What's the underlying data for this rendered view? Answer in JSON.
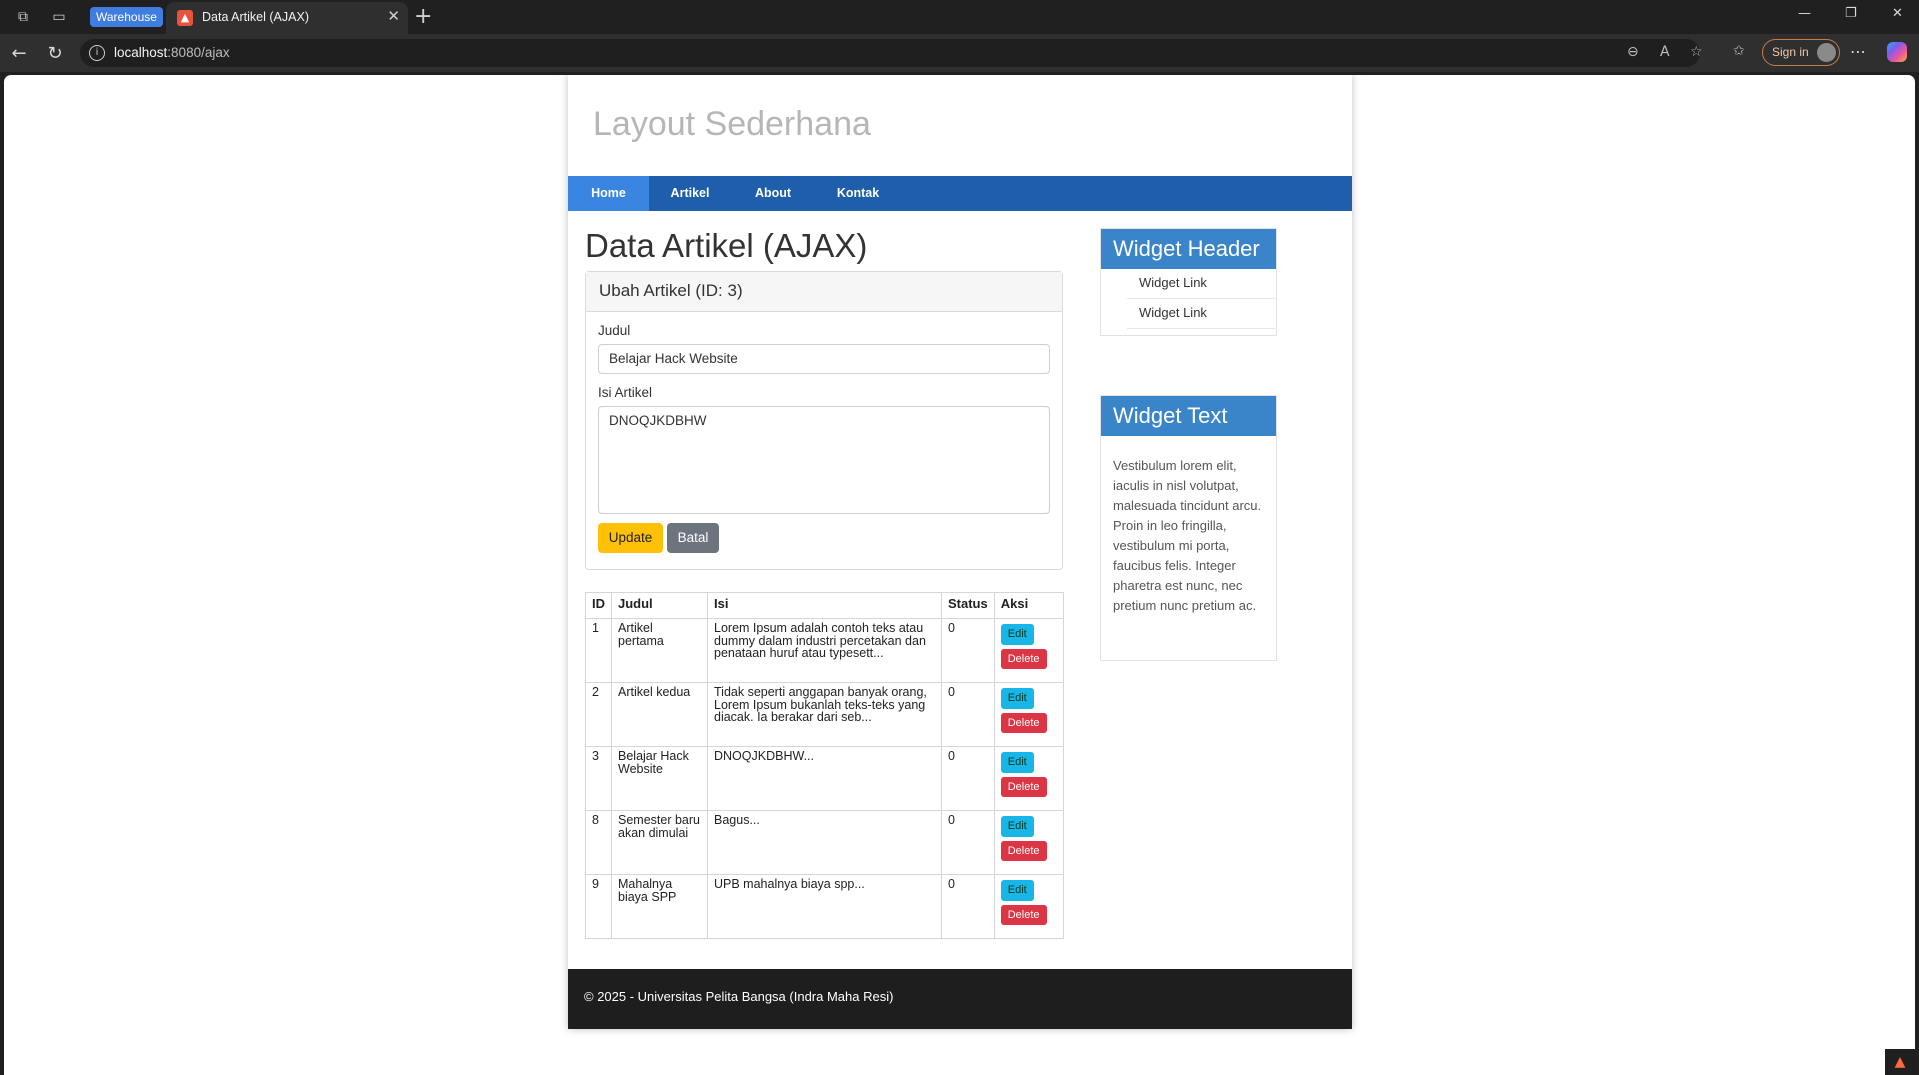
{
  "browser": {
    "workspace_label": "Warehouse",
    "tab_title": "Data Artikel (AJAX)",
    "url_host": "localhost",
    "url_rest": ":8080/ajax",
    "signin_label": "Sign in"
  },
  "site": {
    "title": "Layout Sederhana",
    "nav": [
      {
        "label": "Home",
        "active": true
      },
      {
        "label": "Artikel",
        "active": false
      },
      {
        "label": "About",
        "active": false
      },
      {
        "label": "Kontak",
        "active": false
      }
    ]
  },
  "main": {
    "heading": "Data Artikel (AJAX)",
    "form": {
      "title": "Ubah Artikel (ID: 3)",
      "judul_label": "Judul",
      "judul_value": "Belajar Hack Website",
      "isi_label": "Isi Artikel",
      "isi_value": "DNOQJKDBHW",
      "update_label": "Update",
      "batal_label": "Batal"
    },
    "table": {
      "headers": [
        "ID",
        "Judul",
        "Isi",
        "Status",
        "Aksi"
      ],
      "edit_label": "Edit",
      "delete_label": "Delete",
      "rows": [
        {
          "id": "1",
          "judul": "Artikel pertama",
          "isi": "Lorem Ipsum adalah contoh teks atau dummy dalam industri percetakan dan penataan huruf atau typesett...",
          "status": "0"
        },
        {
          "id": "2",
          "judul": "Artikel kedua",
          "isi": "Tidak seperti anggapan banyak orang, Lorem Ipsum bukanlah teks-teks yang diacak. Ia berakar dari seb...",
          "status": "0"
        },
        {
          "id": "3",
          "judul": "Belajar Hack Website",
          "isi": "DNOQJKDBHW...",
          "status": "0"
        },
        {
          "id": "8",
          "judul": "Semester baru akan dimulai",
          "isi": "Bagus...",
          "status": "0"
        },
        {
          "id": "9",
          "judul": "Mahalnya biaya SPP",
          "isi": "UPB mahalnya biaya spp...",
          "status": "0"
        }
      ]
    }
  },
  "sidebar": {
    "widget_header": "Widget Header",
    "links": [
      "Widget Link",
      "Widget Link"
    ],
    "widget_text_title": "Widget Text",
    "widget_text_body": "Vestibulum lorem elit, iaculis in nisl volutpat, malesuada tincidunt arcu. Proin in leo fringilla, vestibulum mi porta, faucibus felis. Integer pharetra est nunc, nec pretium nunc pretium ac."
  },
  "footer": {
    "text": "© 2025 - Universitas Pelita Bangsa (Indra Maha Resi)"
  },
  "colors": {
    "navbar": "#1e5eaa",
    "nav_active": "#3a85e0",
    "widget_head": "#3a84c9",
    "update_btn": "#ffc107",
    "batal_btn": "#6c757d",
    "edit_btn": "#17b6e6",
    "delete_btn": "#dc3545",
    "footer_bg": "#1e1e1e"
  }
}
